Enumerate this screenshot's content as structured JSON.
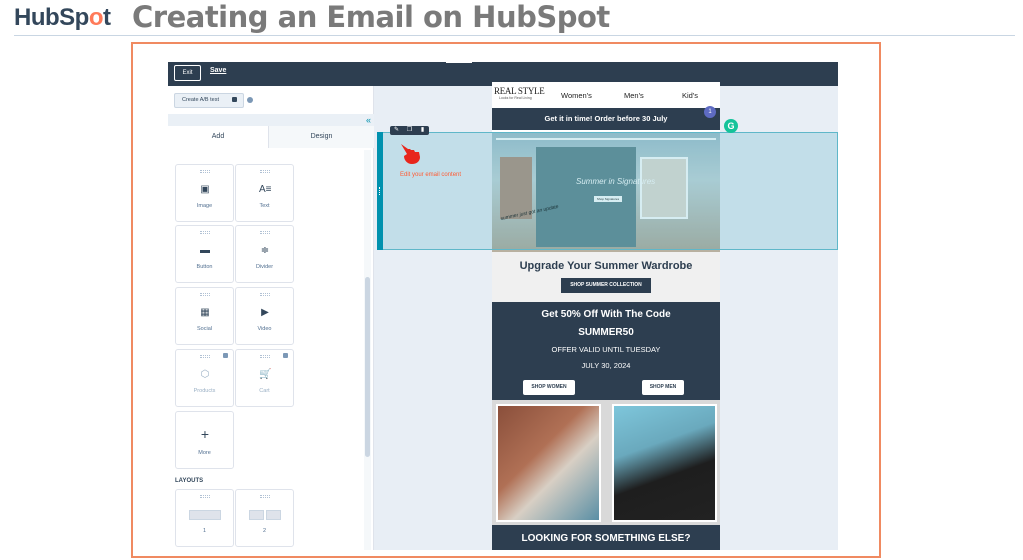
{
  "header": {
    "logo_left": "HubSp",
    "logo_o": "o",
    "logo_right": "t",
    "title": "Creating an Email on HubSpot"
  },
  "editor": {
    "exit_label": "Exit",
    "save_label": "Save",
    "ab_test_label": "Create A/B test",
    "collapse_glyph": "«",
    "tabs": {
      "add": "Add",
      "design": "Design"
    },
    "modules": [
      {
        "label": "Image",
        "icon": "image-icon",
        "glyph": "▣"
      },
      {
        "label": "Text",
        "icon": "text-icon",
        "glyph": "A≡"
      },
      {
        "label": "Button",
        "icon": "button-icon",
        "glyph": "▬"
      },
      {
        "label": "Divider",
        "icon": "divider-icon",
        "glyph": "≑"
      },
      {
        "label": "Social",
        "icon": "social-icon",
        "glyph": "▦"
      },
      {
        "label": "Video",
        "icon": "video-icon",
        "glyph": "▶"
      },
      {
        "label": "Products",
        "icon": "products-icon",
        "glyph": "⬡"
      },
      {
        "label": "Cart",
        "icon": "cart-icon",
        "glyph": "🛒"
      },
      {
        "label": "More",
        "icon": "plus-icon",
        "glyph": "+"
      }
    ],
    "layouts_label": "LAYOUTS",
    "layouts": [
      {
        "label": "1"
      },
      {
        "label": "2"
      }
    ],
    "edit_hint": "Edit your email content",
    "badge_count": "1",
    "grammarly_glyph": "G"
  },
  "email": {
    "brand": "REAL STYLE",
    "brand_sub": "Looks for Real Living",
    "nav": [
      "Women's",
      "Men's",
      "Kid's"
    ],
    "banner": "Get it in time! Order before 30 July",
    "hero_title": "Summer in Signatures",
    "hero_script": "summer just got an update",
    "hero_button": "Shop Signatures",
    "upgrade_title": "Upgrade Your Summer Wardrobe",
    "upgrade_button": "SHOP SUMMER COLLECTION",
    "offer_line1": "Get 50% Off With The Code",
    "offer_code": "SUMMER50",
    "offer_valid": "OFFER VALID UNTIL TUESDAY",
    "offer_date": "JULY 30, 2024",
    "shop_women": "SHOP WOMEN",
    "shop_men": "SHOP MEN",
    "looking": "LOOKING FOR SOMETHING ELSE?"
  },
  "colors": {
    "brand_dark": "#2d3e50",
    "accent_orange": "#ff7a59",
    "frame_orange": "#f08a61",
    "selection_teal": "#0091ae",
    "pointer_red": "#e8261c"
  }
}
